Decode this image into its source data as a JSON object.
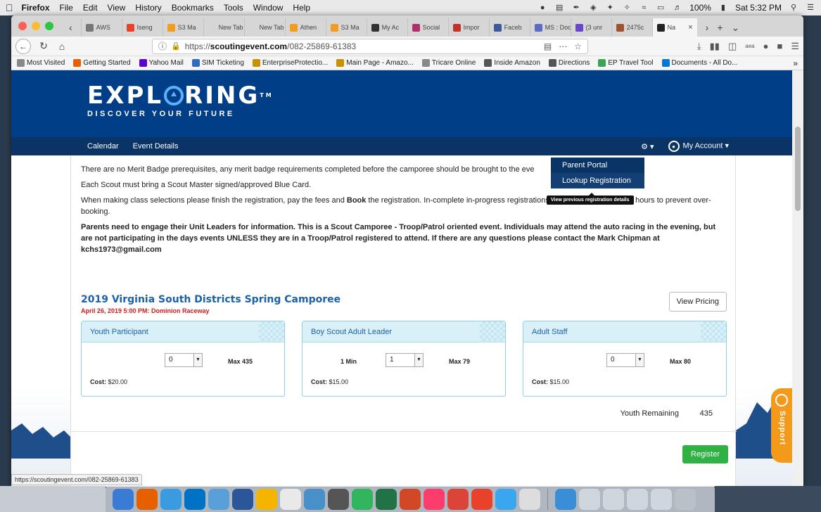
{
  "menubar": {
    "app": "Firefox",
    "items": [
      "File",
      "Edit",
      "View",
      "History",
      "Bookmarks",
      "Tools",
      "Window",
      "Help"
    ],
    "battery": "100%",
    "clock": "Sat 5:32 PM"
  },
  "tabs": [
    {
      "label": "AWS",
      "color": "#777777"
    },
    {
      "label": "Iseng",
      "color": "#e8412c"
    },
    {
      "label": "S3 Ma",
      "color": "#f29b1d"
    },
    {
      "label": "New Tab",
      "color": "#d6d6d6"
    },
    {
      "label": "New Tab",
      "color": "#d6d6d6"
    },
    {
      "label": "Athen",
      "color": "#f29b1d"
    },
    {
      "label": "S3 Ma",
      "color": "#f29b1d"
    },
    {
      "label": "My Ac",
      "color": "#333333"
    },
    {
      "label": "Social",
      "color": "#b0306b"
    },
    {
      "label": "Impor",
      "color": "#c4302b"
    },
    {
      "label": "Faceb",
      "color": "#3b5998"
    },
    {
      "label": "MS : Docu",
      "color": "#5b6bbf"
    },
    {
      "label": "(3 unr",
      "color": "#6a45c8"
    },
    {
      "label": "2475c",
      "color": "#a0522d"
    },
    {
      "label": "Na",
      "color": "#222222"
    }
  ],
  "url": {
    "scheme": "https://",
    "host": "scoutingevent.com",
    "path": "/082-25869-61383"
  },
  "bookmarks": [
    {
      "label": "Most Visited",
      "color": "#888888"
    },
    {
      "label": "Getting Started",
      "color": "#e66000"
    },
    {
      "label": "Yahoo Mail",
      "color": "#5f01d1"
    },
    {
      "label": "SIM Ticketing",
      "color": "#2d6cc0"
    },
    {
      "label": "EnterpriseProtectio...",
      "color": "#c79100"
    },
    {
      "label": "Main Page - Amazo...",
      "color": "#c79100"
    },
    {
      "label": "Tricare Online",
      "color": "#888888"
    },
    {
      "label": "Inside Amazon",
      "color": "#555555"
    },
    {
      "label": "Directions",
      "color": "#555555"
    },
    {
      "label": "EP Travel Tool",
      "color": "#3aa655"
    },
    {
      "label": "Documents - All Do...",
      "color": "#0078d4"
    }
  ],
  "site": {
    "logo_word_pre": "EXPL",
    "logo_word_post": "RING",
    "logo_tm": "TM",
    "tagline": "DISCOVER YOUR FUTURE",
    "nav": [
      "Calendar",
      "Event Details"
    ],
    "account": "My Account",
    "dropdown": [
      "Parent Portal",
      "Lookup Registration"
    ],
    "tooltip": "View previous registration details"
  },
  "notice": {
    "p1": "There are no Merit Badge prerequisites, any merit badge requirements completed before the camporee should be brought to the eve",
    "p2": "Each Scout must bring a Scout Master signed/approved Blue Card.",
    "p3_pre": "When making class selections please finish the registration, pay the fees and ",
    "p3_bold": "Book",
    "p3_post": " the registration. In-complete in-progress registrations will be deleted within 24 hours to prevent over-booking.",
    "p4": "Parents need to engage their Unit Leaders for information.  This is a Scout Camporee - Troop/Patrol oriented event.  Individuals may attend the auto racing in the evening, but are not participating in the days events UNLESS they are in a Troop/Patrol registered to attend. If there are any questions please contact the Mark Chipman at kchs1973@gmail.com"
  },
  "event": {
    "title": "2019 Virginia South Districts Spring Camporee",
    "subtitle": "April 26, 2019 5:00 PM: Dominion Raceway",
    "pricing_button": "View Pricing",
    "cards": [
      {
        "name": "Youth Participant",
        "min": "",
        "select": "0",
        "max": "Max 435",
        "cost_label": "Cost:",
        "cost": "$20.00"
      },
      {
        "name": "Boy Scout Adult Leader",
        "min": "1 Min",
        "select": "1",
        "max": "Max 79",
        "cost_label": "Cost:",
        "cost": "$15.00"
      },
      {
        "name": "Adult Staff",
        "min": "",
        "select": "0",
        "max": "Max 80",
        "cost_label": "Cost:",
        "cost": "$15.00"
      }
    ],
    "remaining_label": "Youth Remaining",
    "remaining_value": "435",
    "register_button": "Register"
  },
  "support_label": "Support",
  "status_url": "https://scoutingevent.com/082-25869-61383",
  "dock_colors": [
    "#3a7bd5",
    "#e66000",
    "#3a9be0",
    "#0072c6",
    "#5aa0d8",
    "#2b579a",
    "#f4b400",
    "#e9e9e9",
    "#4a90c8",
    "#555555",
    "#31b65e",
    "#217346",
    "#d24726",
    "#fc3c6d",
    "#db4437",
    "#e8412c",
    "#3ba6f0",
    "#dddddd",
    "#3a8ed8",
    "#cfd6de",
    "#cfd6de",
    "#cfd6de",
    "#cfd6de",
    "#b8c0c8"
  ]
}
